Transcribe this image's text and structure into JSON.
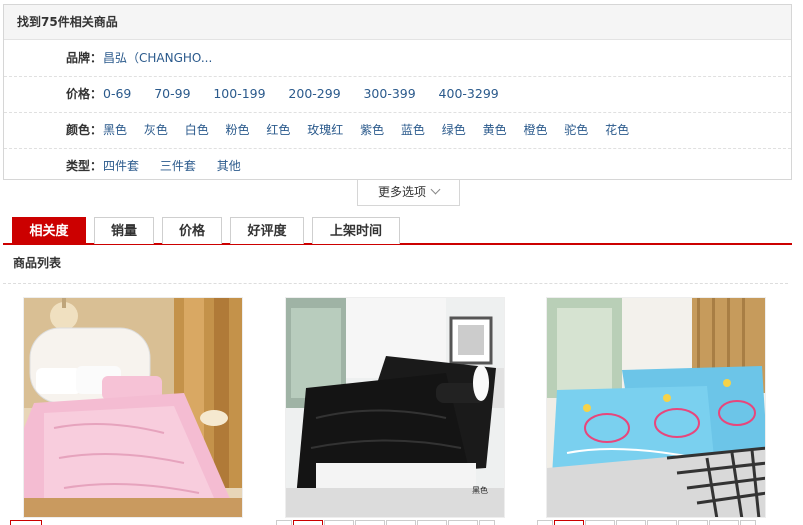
{
  "filter": {
    "header": "找到75件相关商品",
    "brand": {
      "label": "品牌：",
      "values": [
        "昌弘（CHANGHO..."
      ]
    },
    "price": {
      "label": "价格：",
      "values": [
        "0-69",
        "70-99",
        "100-199",
        "200-299",
        "300-399",
        "400-3299"
      ]
    },
    "color": {
      "label": "颜色：",
      "values": [
        "黑色",
        "灰色",
        "白色",
        "粉色",
        "红色",
        "玫瑰红",
        "紫色",
        "蓝色",
        "绿色",
        "黄色",
        "橙色",
        "驼色",
        "花色"
      ]
    },
    "type": {
      "label": "类型：",
      "values": [
        "四件套",
        "三件套",
        "其他"
      ]
    },
    "more": "更多选项"
  },
  "sort": {
    "tabs": [
      "相关度",
      "销量",
      "价格",
      "好评度",
      "上架时间"
    ],
    "active": 0
  },
  "list": {
    "title": "商品列表"
  },
  "products": [
    {
      "image": "pink-quilt-bedroom"
    },
    {
      "image": "black-bedding-set",
      "caption": "黑色"
    },
    {
      "image": "blue-pillowcases"
    }
  ],
  "colors": {
    "accent": "#cc0000",
    "link": "#2b5a8c"
  }
}
